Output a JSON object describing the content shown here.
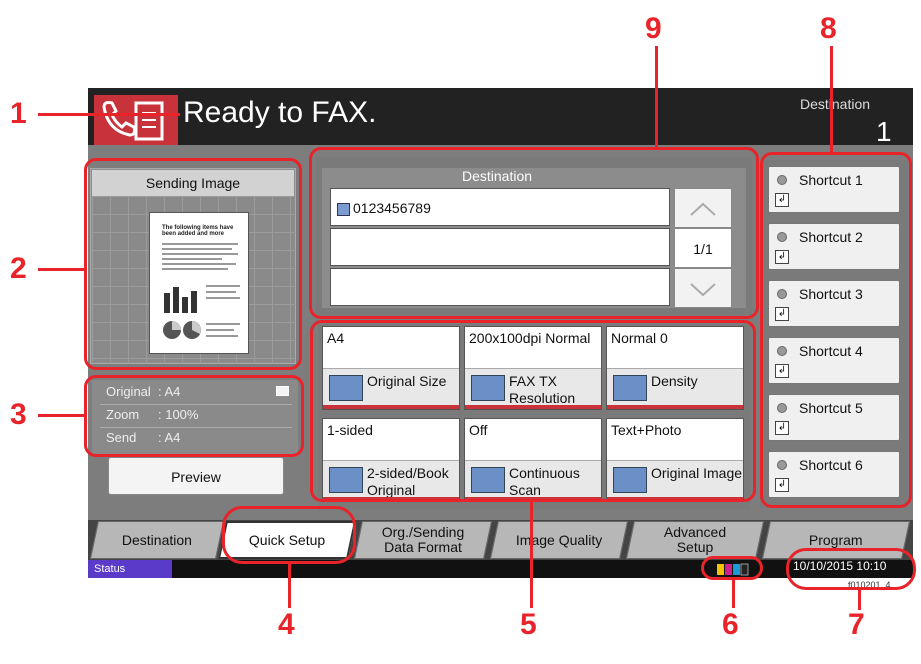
{
  "header": {
    "title": "Ready to FAX.",
    "destination_label": "Destination",
    "destination_count": "1"
  },
  "sending_image": {
    "header": "Sending Image",
    "doc_heading": "The following items have been added and more"
  },
  "settings_info": {
    "rows": [
      {
        "label": "Original",
        "value": ": A4"
      },
      {
        "label": "Zoom",
        "value": ": 100%"
      },
      {
        "label": "Send",
        "value": ": A4"
      }
    ]
  },
  "preview_label": "Preview",
  "destination": {
    "header": "Destination",
    "entries": [
      "0123456789",
      "",
      ""
    ],
    "pager": "1/1"
  },
  "quick_setup": [
    {
      "top": "A4",
      "label": "Original Size",
      "icon": "original-size-icon",
      "red": true
    },
    {
      "top": "200x100dpi Normal",
      "label": "FAX TX Resolution",
      "icon": "dpi-icon",
      "red": true
    },
    {
      "top": "Normal 0",
      "label": "Density",
      "icon": "density-icon",
      "red": true
    },
    {
      "top": "1-sided",
      "label": "2-sided/Book Original",
      "icon": "duplex-icon",
      "red": true
    },
    {
      "top": "Off",
      "label": "Continuous Scan",
      "icon": "continuous-scan-icon",
      "red": true
    },
    {
      "top": "Text+Photo",
      "label": "Original Image",
      "icon": "original-image-icon",
      "red": true
    }
  ],
  "shortcuts": [
    "Shortcut 1",
    "Shortcut 2",
    "Shortcut 3",
    "Shortcut 4",
    "Shortcut 5",
    "Shortcut 6"
  ],
  "tabs": [
    {
      "label": "Destination",
      "active": false
    },
    {
      "label": "Quick Setup",
      "active": true
    },
    {
      "label": "Org./Sending Data Format",
      "active": false
    },
    {
      "label": "Image Quality",
      "active": false
    },
    {
      "label": "Advanced Setup",
      "active": false
    },
    {
      "label": "Program",
      "active": false
    }
  ],
  "status": {
    "button": "Status",
    "datetime": "10/10/2015  10:10",
    "file_id": "f010201_4"
  },
  "callouts": [
    "1",
    "2",
    "3",
    "4",
    "5",
    "6",
    "7",
    "8",
    "9"
  ],
  "colors": {
    "callout_red": "#e8232a",
    "header_bg": "#222222",
    "body_bg": "#7d7d7d",
    "status_purple": "#5a3ac8"
  }
}
